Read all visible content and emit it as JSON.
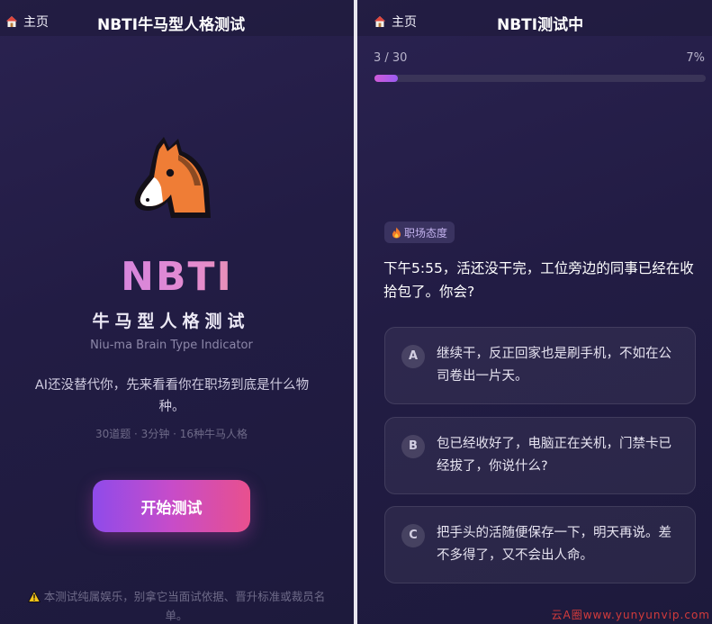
{
  "left": {
    "home_label": "主页",
    "title": "NBTI牛马型人格测试",
    "logo": "NBTI",
    "subtitle": "牛马型人格测试",
    "en_subtitle": "Niu-ma Brain Type Indicator",
    "description": "AI还没替代你，先来看看你在职场到底是什么物种。",
    "meta": "30道题 · 3分钟 · 16种牛马人格",
    "start_button": "开始测试",
    "disclaimer": "本测试纯属娱乐，别拿它当面试依据、晋升标准或裁员名单。",
    "icons": {
      "home": "home-icon",
      "mascot": "horse-face-icon",
      "warning": "warning-icon"
    }
  },
  "right": {
    "home_label": "主页",
    "title": "NBTI测试中",
    "progress": {
      "label": "3 / 30",
      "percent_label": "7%",
      "fraction": 0.07
    },
    "tag": "职场态度",
    "question": "下午5:55，活还没干完，工位旁边的同事已经在收拾包了。你会?",
    "options": [
      {
        "letter": "A",
        "text": "继续干，反正回家也是刷手机，不如在公司卷出一片天。"
      },
      {
        "letter": "B",
        "text": "包已经收好了，电脑正在关机，门禁卡已经拔了，你说什么?"
      },
      {
        "letter": "C",
        "text": "把手头的活随便保存一下，明天再说。差不多得了，又不会出人命。"
      }
    ],
    "watermark": "云A圈www.yunyunvip.com"
  },
  "colors": {
    "accent": "#c74cc9",
    "background": "#221c44"
  }
}
